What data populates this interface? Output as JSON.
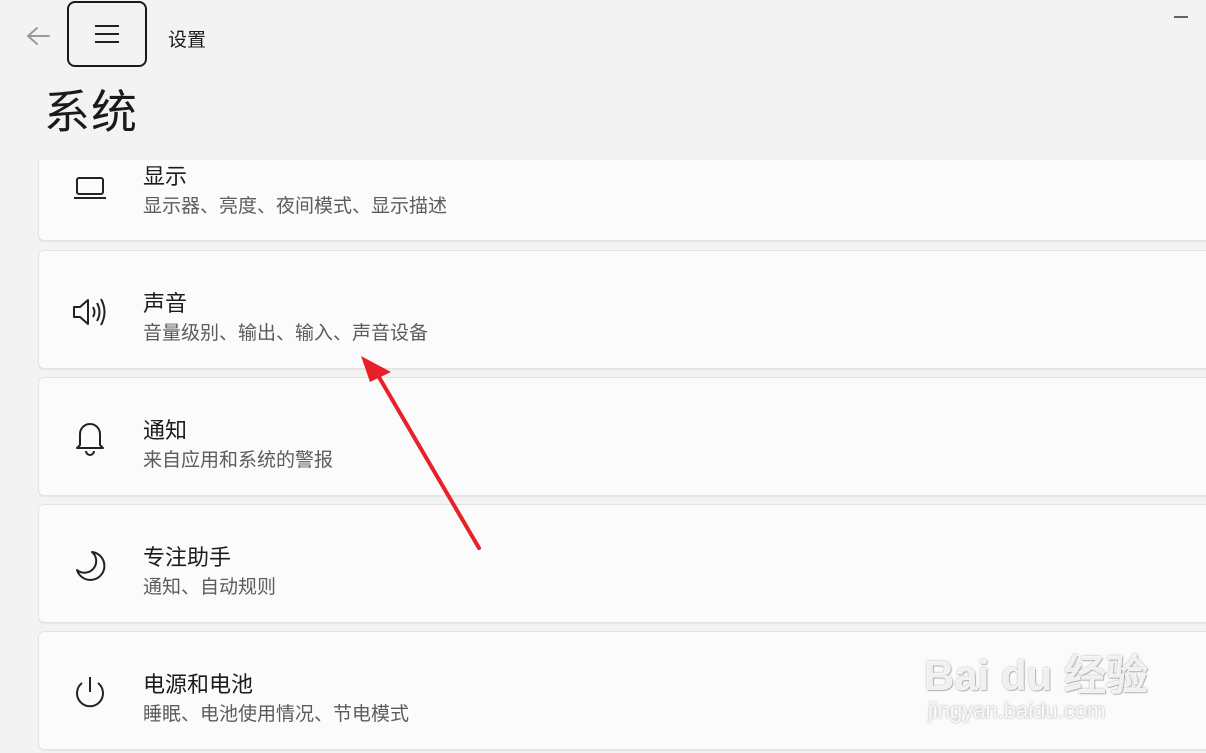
{
  "window": {
    "app_title": "设置"
  },
  "page": {
    "title": "系统"
  },
  "items": [
    {
      "title": "显示",
      "description": "显示器、亮度、夜间模式、显示描述",
      "icon": "monitor-icon"
    },
    {
      "title": "声音",
      "description": "音量级别、输出、输入、声音设备",
      "icon": "speaker-icon"
    },
    {
      "title": "通知",
      "description": "来自应用和系统的警报",
      "icon": "bell-icon"
    },
    {
      "title": "专注助手",
      "description": "通知、自动规则",
      "icon": "moon-icon"
    },
    {
      "title": "电源和电池",
      "description": "睡眠、电池使用情况、节电模式",
      "icon": "power-icon"
    }
  ],
  "annotation": {
    "arrow_color": "#e8202a"
  },
  "watermark": {
    "brand": "Bai du 经验",
    "url": "jingyan.baidu.com"
  }
}
